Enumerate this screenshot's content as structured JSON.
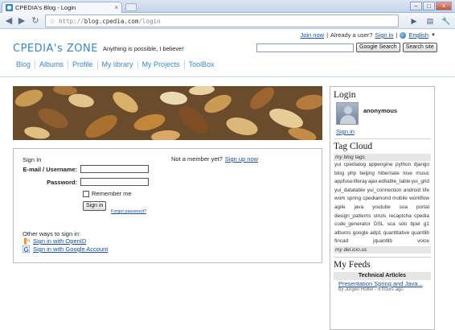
{
  "browser": {
    "tab_title": "CPEDIA's Blog - Login",
    "url_prefix": "http://",
    "url_host": "blog.cpedia.com",
    "url_path": "/login"
  },
  "header": {
    "top_links": {
      "join": "Join now",
      "separator1": "|",
      "already": "Already a user?",
      "sign_in": "Sign in",
      "separator2": "|",
      "language": "English"
    },
    "logo_text": "CPEDIA's ZONE",
    "tagline": "Anything is possible, I believe!",
    "search_button": "Google Search",
    "search_site_button": "Search site"
  },
  "nav": [
    "Blog",
    "Albums",
    "Profile",
    "My library",
    "My Projects",
    "ToolBox"
  ],
  "signin": {
    "heading": "Sign In",
    "email_label": "E-mail / Username:",
    "password_label": "Password:",
    "remember_label": "Remember me",
    "submit": "Sign in",
    "forgot": "Forgot password?",
    "not_member": "Not a member yet?",
    "signup": "Sign up now",
    "other_ways": "Other ways to sign in:",
    "openid": "Sign in with OpenID",
    "google": "Sign in with Google Account"
  },
  "sidebar": {
    "login_title": "Login",
    "username": "anonymous",
    "signin_link": "Sign in",
    "tagcloud_title": "Tag Cloud",
    "my_blog_tags": "my blog tags",
    "tags": [
      "yui",
      "cpedialog",
      "appengine",
      "python",
      "django",
      "blog",
      "php",
      "beijing",
      "hibernate",
      "love",
      "music",
      "appfuse",
      "liferay",
      "ajax",
      "editable_table",
      "yui_grid",
      "yui_datatable",
      "yui_connection",
      "android",
      "life",
      "work",
      "spring",
      "cpediamond",
      "mobile",
      "workflow",
      "agile",
      "java",
      "youtube",
      "soa",
      "portal",
      "design_patterns",
      "struts",
      "recaptcha",
      "cpedia",
      "code_generator",
      "DSL",
      "sca",
      "sdo",
      "bpel",
      "g1",
      "albums",
      "google",
      "adp1",
      "quantitative",
      "quantlib",
      "fincad",
      "jquantlib",
      "voice"
    ],
    "delicious": "my del.icio.us",
    "feeds_title": "My Feeds",
    "feeds_section": "Technical Articles",
    "feed_item": "Presentation Spring and Java...",
    "feed_meta": "by Jürgen Höller - 9 hours ago"
  }
}
